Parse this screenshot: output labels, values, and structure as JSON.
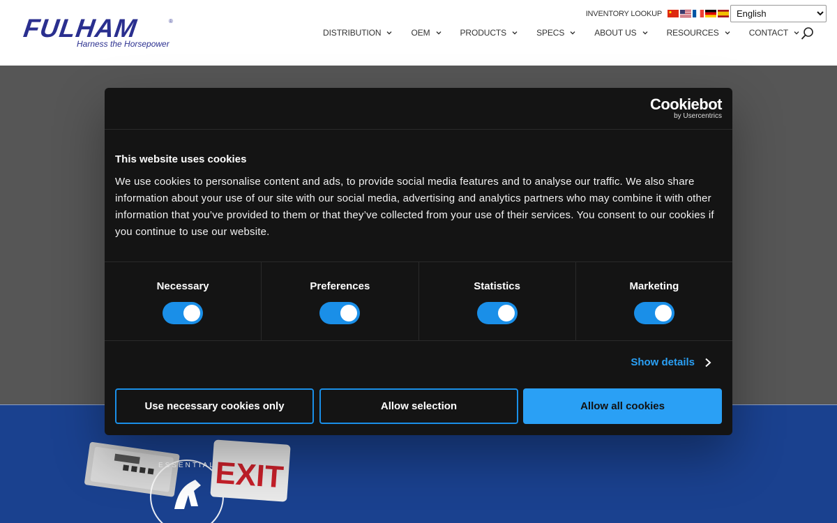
{
  "header": {
    "logo": {
      "brand": "FULHAM",
      "registered": "®",
      "tagline": "Harness the Horsepower"
    },
    "inventory_link": "INVENTORY LOOKUP",
    "flags": [
      "chinese-flag-icon",
      "us-flag-icon",
      "french-flag-icon",
      "german-flag-icon",
      "spanish-flag-icon"
    ],
    "language": {
      "selected": "English"
    },
    "nav": [
      {
        "label": "DISTRIBUTION"
      },
      {
        "label": "OEM"
      },
      {
        "label": "PRODUCTS"
      },
      {
        "label": "SPECS"
      },
      {
        "label": "ABOUT US"
      },
      {
        "label": "RESOURCES"
      },
      {
        "label": "CONTACT"
      }
    ]
  },
  "cookie_dialog": {
    "brand": "Cookiebot",
    "brand_sub": "by Usercentrics",
    "title": "This website uses cookies",
    "body": "We use cookies to personalise content and ads, to provide social media features and to analyse our traffic. We also share information about your use of our site with our social media, advertising and analytics partners who may combine it with other information that you’ve provided to them or that they’ve collected from your use of their services. You consent to our cookies if you continue to use our website.",
    "categories": [
      {
        "label": "Necessary",
        "enabled": true
      },
      {
        "label": "Preferences",
        "enabled": true
      },
      {
        "label": "Statistics",
        "enabled": true
      },
      {
        "label": "Marketing",
        "enabled": true
      }
    ],
    "show_details": "Show details",
    "buttons": {
      "necessary_only": "Use necessary cookies only",
      "allow_selection": "Allow selection",
      "allow_all": "Allow all cookies"
    }
  },
  "colors": {
    "accent": "#2aa0f5",
    "toggle": "#1a8fe8",
    "dialog_bg": "#141414",
    "brand_blue": "#2a2f8f",
    "band_blue": "#1a418f",
    "hero_overlay": "#565656"
  },
  "background_products": {
    "sign_text": "EXIT",
    "badge_text": "ESSENTIAL"
  }
}
